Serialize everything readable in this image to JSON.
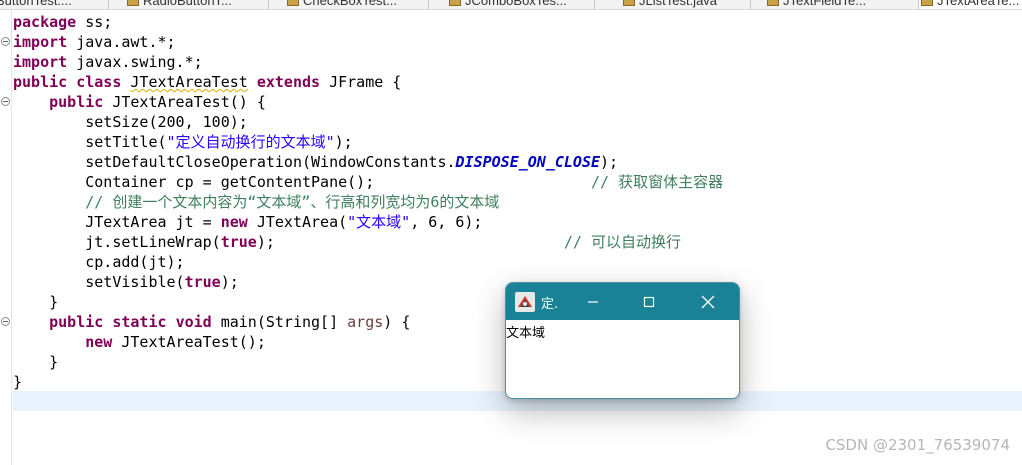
{
  "editor": {
    "tabs": [
      {
        "label": "ButtonTest...."
      },
      {
        "label": "RadioButtonT..."
      },
      {
        "label": "CheckBoxTest..."
      },
      {
        "label": "JComboBoxTes..."
      },
      {
        "label": "JListTest.java"
      },
      {
        "label": "JTextFieldTe..."
      },
      {
        "label": "JTextAreaTe..."
      }
    ],
    "code": {
      "l1": {
        "kw": "package",
        "rest": " ss;"
      },
      "l2": {
        "kw": "import",
        "rest": " java.awt.*;"
      },
      "l3": {
        "kw": "import",
        "rest": " javax.swing.*;"
      },
      "l4": {
        "kw1": "public",
        "kw2": "class",
        "name": "JTextAreaTest",
        "kw3": "extends",
        "rest": " JFrame {"
      },
      "l5": {
        "kw": "public",
        "rest": " JTextAreaTest() {"
      },
      "l6": {
        "text": "setSize(200, 100);"
      },
      "l7": {
        "pre": "setTitle(",
        "str": "\"定义自动换行的文本域\"",
        "post": ");"
      },
      "l8": {
        "pre": "setDefaultCloseOperation(WindowConstants.",
        "const": "DISPOSE_ON_CLOSE",
        "post": ");"
      },
      "l9": {
        "text": "Container cp = getContentPane();",
        "comment": "// 获取窗体主容器"
      },
      "l10": {
        "comment": "// 创建一个文本内容为“文本域”、行高和列宽均为6的文本域"
      },
      "l11": {
        "pre": "JTextArea jt = ",
        "kw": "new",
        "mid": " JTextArea(",
        "str": "\"文本域\"",
        "post": ", 6, 6);"
      },
      "l12": {
        "pre": "jt.setLineWrap(",
        "kw": "true",
        "post": ");",
        "comment": "// 可以自动换行"
      },
      "l13": {
        "text": "cp.add(jt);"
      },
      "l14": {
        "pre": "setVisible(",
        "kw": "true",
        "post": ");"
      },
      "l15": {
        "text": "}"
      },
      "l16": {
        "kw1": "public",
        "kw2": "static",
        "kw3": "void",
        "pre": " main(String[] ",
        "args": "args",
        "post": ") {"
      },
      "l17": {
        "kw": "new",
        "rest": " JTextAreaTest();"
      },
      "l18": {
        "text": "}"
      },
      "l19": {
        "text": "}"
      }
    }
  },
  "app_window": {
    "title": "定.",
    "textarea_value": "文本域",
    "colors": {
      "titlebar": "#1a8296"
    }
  },
  "watermark": "CSDN @2301_76539074"
}
